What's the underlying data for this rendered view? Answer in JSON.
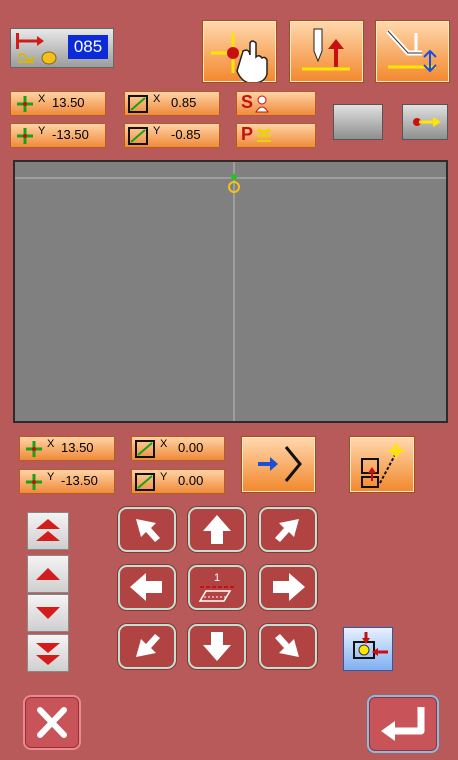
{
  "status": {
    "program_number": "085"
  },
  "top_pads": {
    "x_coord": "13.50",
    "y_coord": "-13.50",
    "x_scale": "0.85",
    "y_scale": "-0.85"
  },
  "bottom_pads": {
    "x_coord": "13.50",
    "y_coord": "-13.50",
    "x_offset": "0.00",
    "y_offset": "0.00"
  },
  "labels": {
    "s_label": "S",
    "p_label": "P",
    "x_sup": "X",
    "y_sup": "Y"
  },
  "icons": [
    "thread-icon",
    "presser-foot-icon",
    "crosshair-hand-icon",
    "needle-up-icon",
    "presser-lift-icon",
    "move-right-icon",
    "shape-icon",
    "enter-icon",
    "pattern-convert-icon",
    "speed-up-fast-icon",
    "speed-up-icon",
    "speed-down-icon",
    "speed-down-fast-icon",
    "stitch-icon",
    "sew-here-icon",
    "close-icon",
    "return-icon"
  ],
  "colors": {
    "background": "#b85a5a",
    "canvas": "#808080",
    "program_number_bg": "#0b2ad8",
    "pad_orange": "#f08a3a"
  }
}
